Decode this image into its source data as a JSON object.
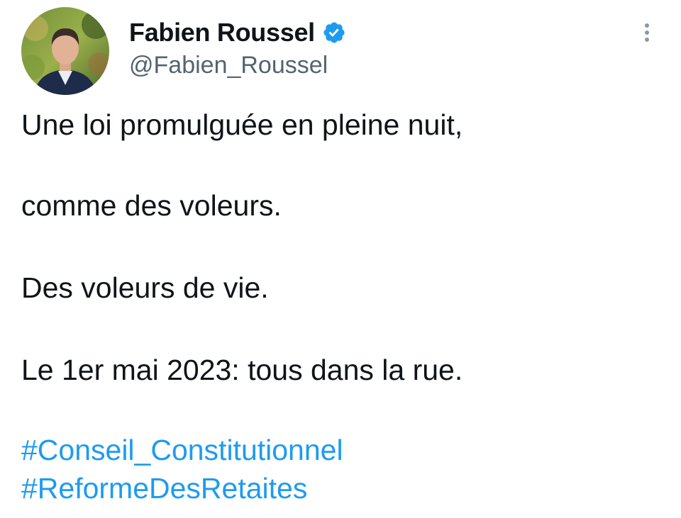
{
  "author": {
    "display_name": "Fabien Roussel",
    "handle": "@Fabien_Roussel",
    "verified_icon": "verified-badge-icon"
  },
  "more_icon": "more-vertical-icon",
  "tweet": {
    "lines": [
      "Une loi promulguée en pleine nuit,",
      "comme des voleurs.",
      "Des voleurs de vie.",
      "Le 1er mai 2023: tous dans la rue."
    ],
    "hashtags": [
      "#Conseil_Constitutionnel",
      "#ReformeDesRetaites"
    ]
  },
  "colors": {
    "text": "#0f1419",
    "secondary": "#536471",
    "link": "#1d9bf0",
    "verified": "#1d9bf0"
  }
}
